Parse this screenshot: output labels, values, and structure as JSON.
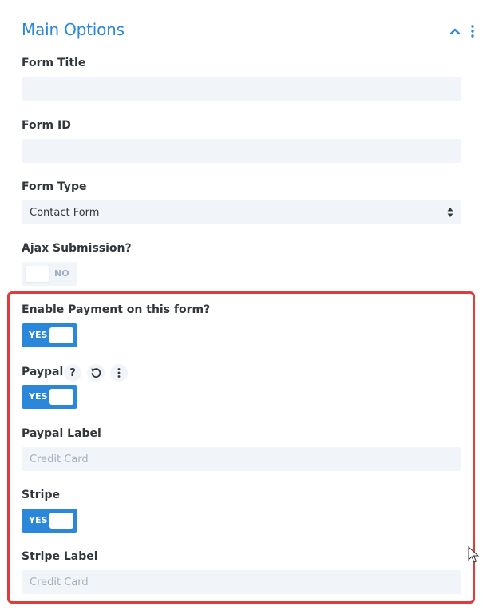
{
  "header": {
    "title": "Main Options",
    "collapse_icon": "chevron-up-icon",
    "menu_icon": "kebab-menu-icon"
  },
  "fields": {
    "form_title": {
      "label": "Form Title",
      "value": ""
    },
    "form_id": {
      "label": "Form ID",
      "value": ""
    },
    "form_type": {
      "label": "Form Type",
      "value": "Contact Form"
    },
    "ajax_submission": {
      "label": "Ajax Submission?",
      "state": "NO"
    },
    "enable_payment": {
      "label": "Enable Payment on this form?",
      "state": "YES"
    },
    "paypal": {
      "label": "Paypal",
      "state": "YES",
      "help_icon_text": "?"
    },
    "paypal_label": {
      "label": "Paypal Label",
      "placeholder": "Credit Card"
    },
    "stripe": {
      "label": "Stripe",
      "state": "YES"
    },
    "stripe_label": {
      "label": "Stripe Label",
      "placeholder": "Credit Card"
    }
  },
  "colors": {
    "accent": "#2b87da",
    "highlight": "#e03c3c",
    "field_bg": "#f1f5f9"
  }
}
